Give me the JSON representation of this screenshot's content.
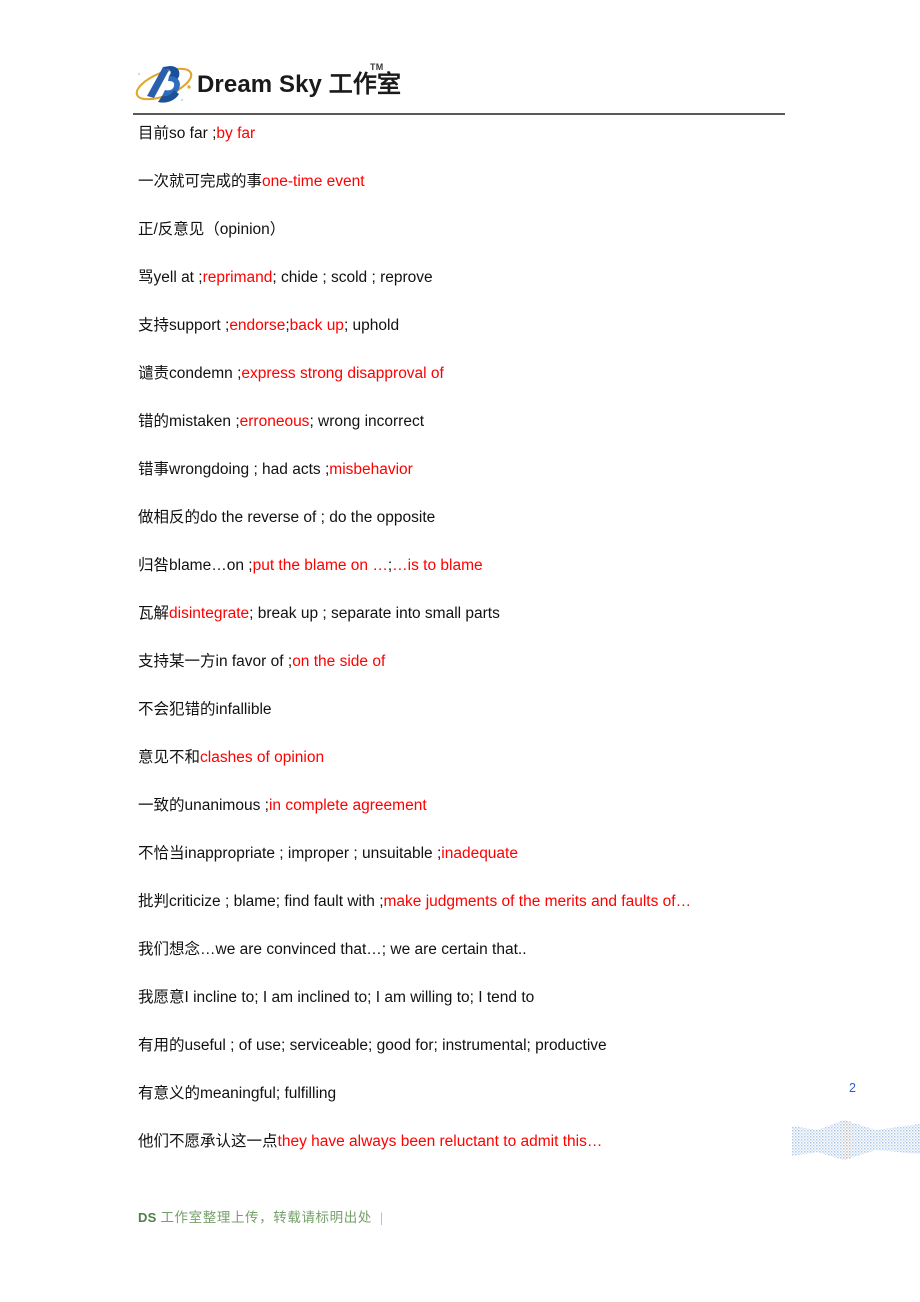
{
  "header": {
    "logo_text": "Dream Sky 工作室",
    "trademark": "TM",
    "logo_icon": "ds-monogram-orbit-logo"
  },
  "page_number": "2",
  "footer": {
    "mark": "DS",
    "text": "工作室整理上传，转载请标明出处",
    "bar": "|"
  },
  "content": {
    "lines": [
      {
        "segments": [
          {
            "text": "目前so far ; ",
            "color": "black"
          },
          {
            "text": "by far",
            "color": "red"
          }
        ]
      },
      {
        "segments": [
          {
            "text": "一次就可完成的事",
            "color": "black"
          },
          {
            "text": "one-time event",
            "color": "red"
          }
        ]
      },
      {
        "segments": [
          {
            "text": "正/反意见（opinion）",
            "color": "black"
          }
        ]
      },
      {
        "segments": [
          {
            "text": "骂yell at ; ",
            "color": "black"
          },
          {
            "text": "reprimand",
            "color": "red"
          },
          {
            "text": " ; chide ; scold ; reprove",
            "color": "black"
          }
        ]
      },
      {
        "segments": [
          {
            "text": "支持support ; ",
            "color": "black"
          },
          {
            "text": "endorse",
            "color": "red"
          },
          {
            "text": " ; ",
            "color": "black"
          },
          {
            "text": "back up",
            "color": "red"
          },
          {
            "text": " ; uphold",
            "color": "black"
          }
        ]
      },
      {
        "segments": [
          {
            "text": "谴责condemn ; ",
            "color": "black"
          },
          {
            "text": "express strong disapproval of",
            "color": "red"
          }
        ]
      },
      {
        "segments": [
          {
            "text": "错的mistaken ; ",
            "color": "black"
          },
          {
            "text": "erroneous",
            "color": "red"
          },
          {
            "text": " ; wrong   incorrect",
            "color": "black"
          }
        ]
      },
      {
        "segments": [
          {
            "text": "错事wrongdoing ; had acts ; ",
            "color": "black"
          },
          {
            "text": "misbehavior",
            "color": "red"
          }
        ]
      },
      {
        "segments": [
          {
            "text": "做相反的do the reverse of ; do the opposite",
            "color": "black"
          }
        ]
      },
      {
        "segments": [
          {
            "text": "归咎blame…on ; ",
            "color": "black"
          },
          {
            "text": "put the blame on …",
            "color": "red"
          },
          {
            "text": " ; ",
            "color": "black"
          },
          {
            "text": "…is to blame",
            "color": "red"
          }
        ]
      },
      {
        "segments": [
          {
            "text": "瓦解",
            "color": "black"
          },
          {
            "text": "disintegrate",
            "color": "red"
          },
          {
            "text": " ; break up ; separate into small parts",
            "color": "black"
          }
        ]
      },
      {
        "segments": [
          {
            "text": "支持某一方in favor of ; ",
            "color": "black"
          },
          {
            "text": "on the side of",
            "color": "red"
          }
        ]
      },
      {
        "segments": [
          {
            "text": "不会犯错的infallible",
            "color": "black"
          }
        ]
      },
      {
        "segments": [
          {
            "text": "意见不和",
            "color": "black"
          },
          {
            "text": "clashes of opinion",
            "color": "red"
          }
        ]
      },
      {
        "segments": [
          {
            "text": "一致的unanimous ; ",
            "color": "black"
          },
          {
            "text": "in complete agreement",
            "color": "red"
          }
        ]
      },
      {
        "segments": [
          {
            "text": "不恰当inappropriate ; improper ; unsuitable ; ",
            "color": "black"
          },
          {
            "text": "inadequate",
            "color": "red"
          }
        ]
      },
      {
        "segments": [
          {
            "text": "批判criticize ; blame; find fault with ; ",
            "color": "black"
          },
          {
            "text": "make judgments of the merits and faults of…",
            "color": "red"
          }
        ]
      },
      {
        "segments": [
          {
            "text": "我们想念…we are convinced that…; we are certain that..",
            "color": "black"
          }
        ]
      },
      {
        "segments": [
          {
            "text": "我愿意I incline to; I am inclined to; I am willing to; I tend to",
            "color": "black"
          }
        ]
      },
      {
        "segments": [
          {
            "text": "有用的useful ; of use; serviceable; good for; instrumental; productive",
            "color": "black"
          }
        ]
      },
      {
        "segments": [
          {
            "text": "有意义的meaningful; fulfilling",
            "color": "black"
          }
        ]
      },
      {
        "segments": [
          {
            "text": "他们不愿承认这一点",
            "color": "black"
          },
          {
            "text": "they have always been reluctant to admit this…",
            "color": "red"
          }
        ]
      }
    ]
  },
  "colors": {
    "highlight": "#FF0000",
    "body_text": "#111111",
    "rule": "#595959",
    "page_number": "#2a63c4",
    "footer_text": "#76a06a",
    "logo_blue": "#1a4f9c",
    "logo_gold": "#e0a72c"
  }
}
